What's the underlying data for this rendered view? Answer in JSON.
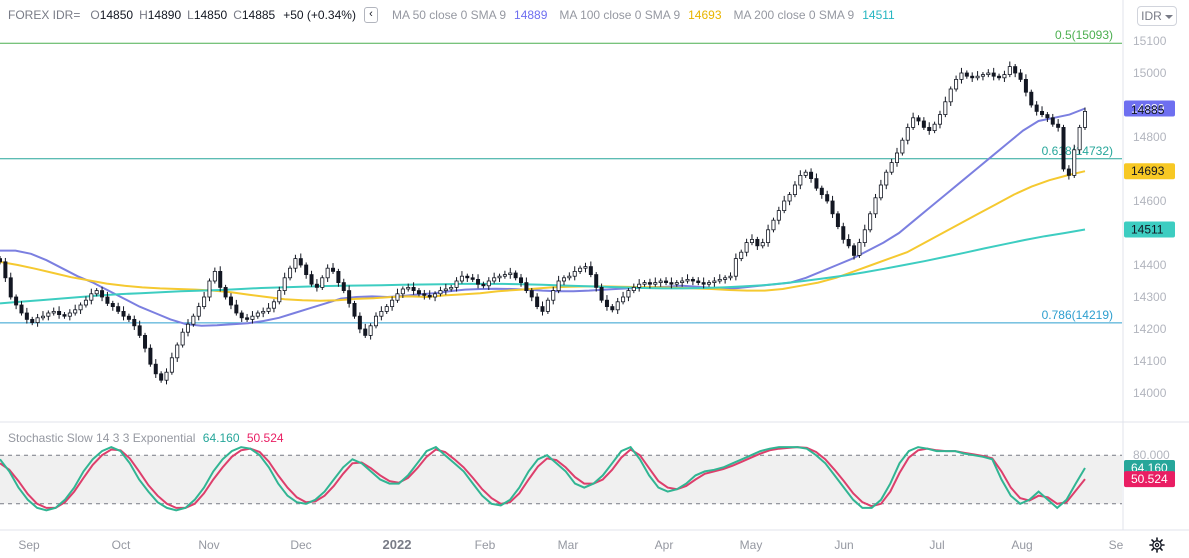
{
  "header": {
    "symbol": "FOREX IDR=",
    "ohlc": {
      "o_label": "O",
      "o": "14850",
      "h_label": "H",
      "h": "14890",
      "l_label": "L",
      "l": "14850",
      "c_label": "C",
      "c": "14885"
    },
    "change": "+50 (+0.34%)",
    "collapse_glyph": "‹",
    "ma50_label": "MA 50 close 0 SMA 9",
    "ma50_value": "14889",
    "ma100_label": "MA 100 close 0 SMA 9",
    "ma100_value": "14693",
    "ma200_label": "MA 200 close 0 SMA 9",
    "ma200_value": "14511",
    "currency": "IDR"
  },
  "stoch_legend": {
    "title": "Stochastic Slow 14 3 3 Exponential",
    "k_value": "64.160",
    "d_value": "50.524"
  },
  "colors": {
    "ma50": "#7b7fe0",
    "ma100": "#f5c930",
    "ma200": "#3dcdc1",
    "stoch_k": "#31b593",
    "stoch_d": "#dd3f6c",
    "fib05": "#4caf50",
    "fib0618": "#26a69a",
    "fib0786": "#2e9fcf",
    "ma50_tag": "#6e6ff0",
    "ma100_tag": "#f7c824",
    "ma200_tag": "#3dcdc1",
    "stoch_k_tag": "#26a69a",
    "stoch_d_tag": "#e91e63"
  },
  "chart_data": [
    {
      "type": "candlestick",
      "title": "FOREX IDR=",
      "x_ticks": [
        "Sep",
        "Oct",
        "Nov",
        "Dec",
        "2022",
        "Feb",
        "Mar",
        "Apr",
        "May",
        "Jun",
        "Jul",
        "Aug",
        "Se"
      ],
      "y_ticks": [
        "15100",
        "15000",
        "14900",
        "14800",
        "14700",
        "14600",
        "14500",
        "14400",
        "14300",
        "14200",
        "14100",
        "14000"
      ],
      "ylim": [
        13930,
        15160
      ],
      "close_series": [
        14410,
        14360,
        14300,
        14275,
        14250,
        14230,
        14220,
        14235,
        14240,
        14250,
        14255,
        14245,
        14240,
        14250,
        14260,
        14275,
        14290,
        14310,
        14320,
        14300,
        14280,
        14270,
        14255,
        14240,
        14230,
        14210,
        14180,
        14140,
        14090,
        14060,
        14040,
        14065,
        14110,
        14150,
        14190,
        14215,
        14240,
        14270,
        14300,
        14350,
        14380,
        14330,
        14300,
        14275,
        14250,
        14235,
        14230,
        14240,
        14250,
        14255,
        14265,
        14285,
        14320,
        14360,
        14390,
        14420,
        14400,
        14370,
        14340,
        14330,
        14360,
        14390,
        14380,
        14345,
        14320,
        14280,
        14240,
        14200,
        14180,
        14210,
        14240,
        14255,
        14270,
        14290,
        14310,
        14325,
        14330,
        14320,
        14310,
        14305,
        14300,
        14310,
        14320,
        14325,
        14330,
        14350,
        14365,
        14360,
        14355,
        14340,
        14335,
        14350,
        14360,
        14365,
        14370,
        14375,
        14360,
        14345,
        14320,
        14300,
        14270,
        14255,
        14290,
        14320,
        14350,
        14360,
        14365,
        14380,
        14390,
        14395,
        14370,
        14330,
        14290,
        14270,
        14260,
        14285,
        14300,
        14320,
        14330,
        14340,
        14345,
        14340,
        14345,
        14350,
        14345,
        14340,
        14345,
        14350,
        14355,
        14350,
        14345,
        14340,
        14345,
        14350,
        14355,
        14360,
        14365,
        14420,
        14440,
        14470,
        14480,
        14460,
        14470,
        14510,
        14540,
        14570,
        14600,
        14620,
        14650,
        14680,
        14690,
        14670,
        14640,
        14620,
        14600,
        14560,
        14520,
        14480,
        14460,
        14430,
        14470,
        14510,
        14560,
        14610,
        14650,
        14690,
        14720,
        14750,
        14790,
        14830,
        14860,
        14850,
        14830,
        14820,
        14840,
        14870,
        14910,
        14950,
        14980,
        15000,
        14990,
        14985,
        14990,
        14995,
        15000,
        14990,
        14985,
        14995,
        15020,
        15000,
        14980,
        14940,
        14900,
        14880,
        14870,
        14860,
        14840,
        14830,
        14700,
        14680,
        14760,
        14830,
        14880
      ],
      "current_price": "14885",
      "fib_levels": [
        {
          "label": "0.5(15093)",
          "value": 15093
        },
        {
          "label": "0.618(14732)",
          "value": 14732
        },
        {
          "label": "0.786(14219)",
          "value": 14219
        }
      ],
      "ma_series": [
        {
          "name": "MA 50 close 0 SMA 9",
          "last": 14889,
          "values": [
            14445,
            14445,
            14435,
            14415,
            14390,
            14365,
            14345,
            14320,
            14295,
            14270,
            14250,
            14230,
            14215,
            14210,
            14212,
            14215,
            14218,
            14225,
            14235,
            14250,
            14265,
            14280,
            14295,
            14300,
            14302,
            14300,
            14303,
            14308,
            14312,
            14318,
            14323,
            14325,
            14326,
            14325,
            14323,
            14320,
            14318,
            14318,
            14320,
            14323,
            14326,
            14328,
            14330,
            14332,
            14335,
            14332,
            14328,
            14325,
            14330,
            14335,
            14340,
            14345,
            14360,
            14380,
            14400,
            14420,
            14445,
            14470,
            14500,
            14540,
            14580,
            14620,
            14660,
            14700,
            14740,
            14780,
            14820,
            14850,
            14860,
            14870,
            14889
          ]
        },
        {
          "name": "MA 100 close 0 SMA 9",
          "last": 14693,
          "values": [
            14410,
            14400,
            14388,
            14375,
            14362,
            14352,
            14342,
            14335,
            14330,
            14327,
            14325,
            14323,
            14320,
            14315,
            14307,
            14300,
            14293,
            14290,
            14288,
            14290,
            14294,
            14296,
            14300,
            14302,
            14300,
            14305,
            14308,
            14312,
            14318,
            14322,
            14326,
            14330,
            14332,
            14333,
            14333,
            14332,
            14331,
            14330,
            14329,
            14327,
            14325,
            14322,
            14320,
            14320,
            14325,
            14335,
            14345,
            14360,
            14380,
            14400,
            14420,
            14440,
            14470,
            14500,
            14530,
            14560,
            14590,
            14620,
            14645,
            14665,
            14680,
            14693
          ]
        },
        {
          "name": "MA 200 close 0 SMA 9",
          "last": 14511,
          "values": [
            14280,
            14285,
            14290,
            14295,
            14300,
            14305,
            14309,
            14312,
            14315,
            14318,
            14320,
            14322,
            14325,
            14328,
            14330,
            14332,
            14334,
            14335,
            14336,
            14337,
            14338,
            14339,
            14340,
            14341,
            14341,
            14341,
            14340,
            14338,
            14336,
            14334,
            14332,
            14330,
            14328,
            14327,
            14327,
            14328,
            14330,
            14333,
            14337,
            14343,
            14350,
            14358,
            14367,
            14377,
            14388,
            14400,
            14412,
            14425,
            14438,
            14452,
            14465,
            14478,
            14490,
            14500,
            14511
          ]
        }
      ]
    },
    {
      "type": "line",
      "title": "Stochastic Slow 14 3 3 Exponential",
      "y_ticks": [
        "80.000"
      ],
      "levels": [
        80,
        20
      ],
      "ylim": [
        0,
        100
      ],
      "series": [
        {
          "name": "K",
          "last": 64.16,
          "values": [
            75,
            60,
            40,
            25,
            15,
            12,
            15,
            25,
            40,
            60,
            75,
            85,
            90,
            85,
            70,
            50,
            35,
            22,
            15,
            12,
            15,
            25,
            40,
            60,
            75,
            85,
            90,
            88,
            80,
            65,
            45,
            30,
            22,
            20,
            25,
            35,
            50,
            65,
            75,
            70,
            60,
            50,
            45,
            45,
            55,
            70,
            85,
            90,
            80,
            70,
            60,
            45,
            30,
            20,
            18,
            25,
            40,
            60,
            75,
            80,
            70,
            60,
            45,
            40,
            45,
            55,
            70,
            85,
            90,
            75,
            55,
            40,
            35,
            38,
            45,
            55,
            60,
            62,
            65,
            70,
            75,
            80,
            85,
            88,
            90,
            90,
            90,
            88,
            80,
            70,
            55,
            40,
            25,
            15,
            15,
            25,
            45,
            70,
            85,
            90,
            88,
            85,
            85,
            85,
            82,
            80,
            78,
            75,
            50,
            30,
            20,
            25,
            35,
            25,
            15,
            25,
            45,
            64.16
          ]
        },
        {
          "name": "D",
          "last": 50.524,
          "values": [
            70,
            62,
            48,
            32,
            20,
            15,
            15,
            22,
            35,
            52,
            68,
            80,
            87,
            86,
            76,
            60,
            43,
            30,
            20,
            15,
            15,
            20,
            33,
            50,
            65,
            78,
            86,
            88,
            84,
            72,
            55,
            40,
            28,
            22,
            23,
            30,
            42,
            57,
            70,
            71,
            64,
            55,
            48,
            46,
            52,
            64,
            78,
            87,
            84,
            75,
            65,
            52,
            38,
            27,
            20,
            22,
            33,
            50,
            66,
            76,
            74,
            65,
            53,
            45,
            45,
            50,
            62,
            77,
            87,
            80,
            64,
            48,
            40,
            38,
            42,
            50,
            57,
            60,
            63,
            67,
            72,
            77,
            82,
            86,
            88,
            89,
            90,
            89,
            84,
            75,
            62,
            48,
            33,
            22,
            17,
            20,
            35,
            58,
            77,
            86,
            88,
            86,
            85,
            85,
            83,
            81,
            79,
            76,
            60,
            40,
            27,
            24,
            30,
            28,
            20,
            22,
            36,
            50.524
          ]
        }
      ]
    }
  ]
}
